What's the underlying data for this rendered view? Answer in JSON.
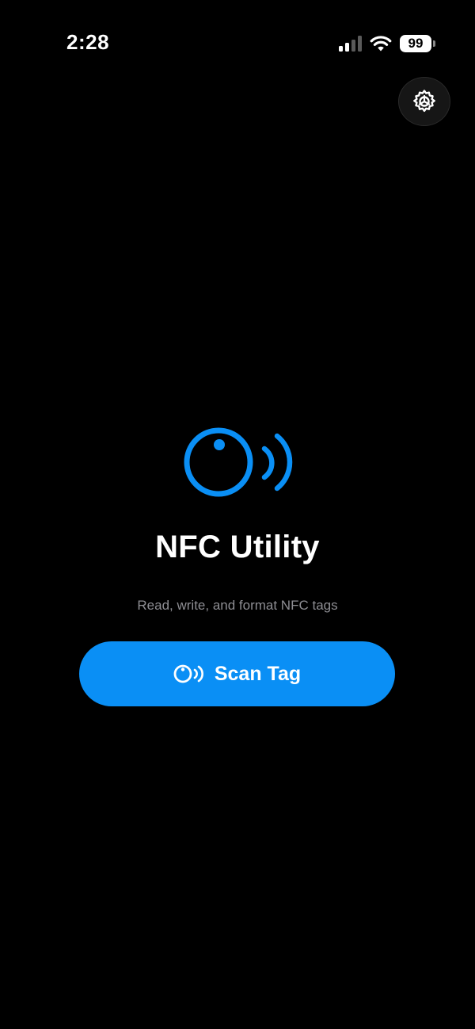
{
  "status_bar": {
    "time": "2:28",
    "battery_level": "99",
    "signal_bars_active": 2,
    "icons": [
      "cellular-signal-icon",
      "wifi-icon",
      "battery-icon"
    ]
  },
  "header": {
    "settings_icon": "gear-icon"
  },
  "main": {
    "hero_icon": "nfc-tag-icon",
    "title": "NFC Utility",
    "subtitle": "Read, write, and format NFC tags",
    "scan_button": {
      "label": "Scan Tag",
      "icon": "nfc-tag-icon"
    }
  },
  "colors": {
    "background": "#000000",
    "accent": "#0A8FF5",
    "title": "#FFFFFF",
    "subtitle": "#8E8E93",
    "settings_bg": "#161616"
  }
}
